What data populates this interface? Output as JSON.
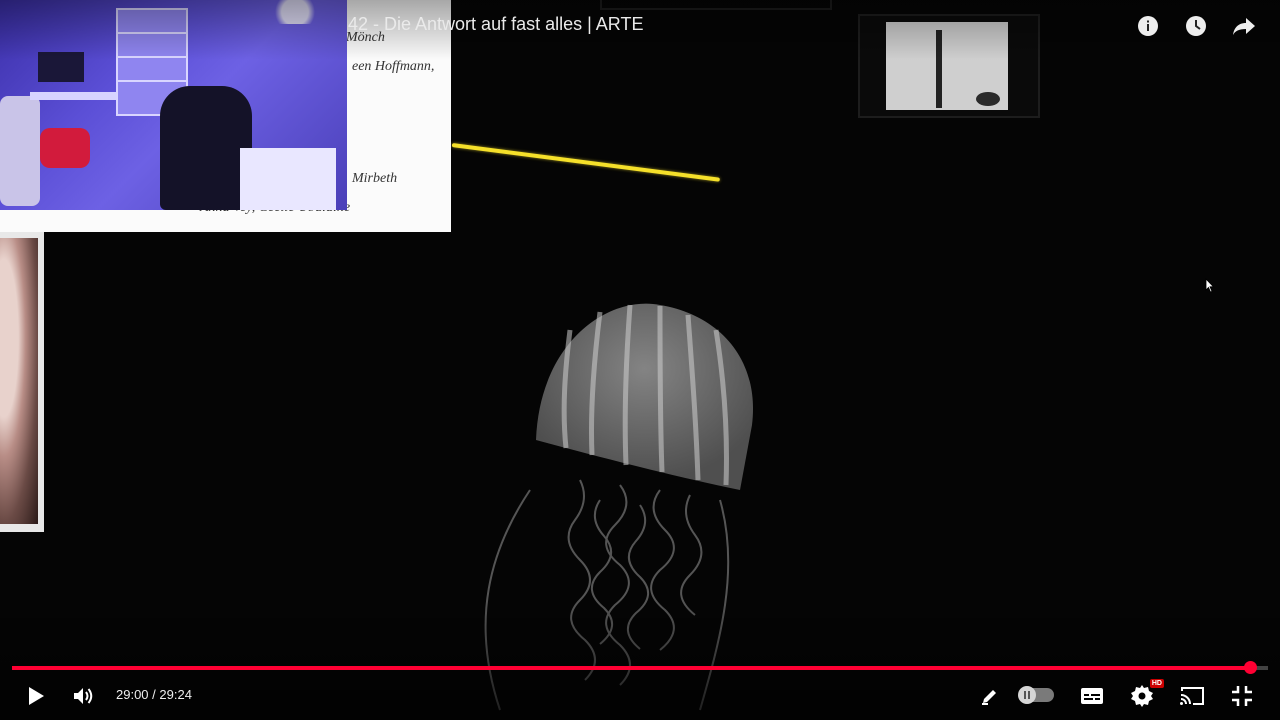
{
  "player": {
    "title": "42 - Die Antwort auf fast alles | ARTE",
    "current_time": "29:00",
    "separator": "/",
    "duration": "29:24",
    "progress": 0.986,
    "accent_color": "#ff0033",
    "hd_badge": "HD"
  },
  "top_icons": [
    "info-icon",
    "watch-later-icon",
    "share-icon"
  ],
  "bottom_icons": [
    "play-icon",
    "volume-icon",
    "pen-icon",
    "autoplay-toggle",
    "subtitles-icon",
    "settings-icon",
    "cast-icon",
    "exit-fullscreen-icon"
  ],
  "overlay_paper": {
    "line1": "Mönch",
    "line2": "een Hoffmann,",
    "line3": "Mirbeth",
    "line4": "Anna Vey, Cécile Ubaldine"
  }
}
